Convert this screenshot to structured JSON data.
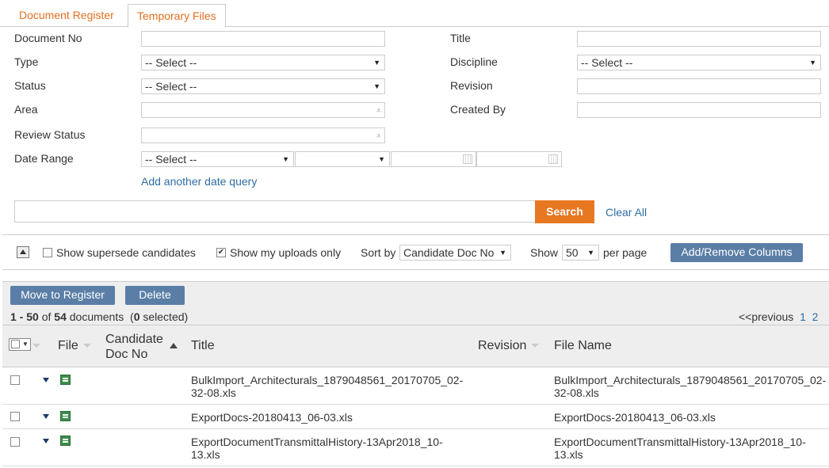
{
  "tabs": [
    "Document Register",
    "Temporary Files"
  ],
  "filters": {
    "document_no": "Document No",
    "title": "Title",
    "type": "Type",
    "type_value": "-- Select --",
    "discipline": "Discipline",
    "discipline_value": "-- Select --",
    "status": "Status",
    "status_value": "-- Select --",
    "revision": "Revision",
    "area": "Area",
    "created_by": "Created By",
    "review_status": "Review Status",
    "date_range": "Date Range",
    "date_range_value": "-- Select --",
    "add_date_query": "Add another date query"
  },
  "search": {
    "button": "Search",
    "clear": "Clear All"
  },
  "options": {
    "supersede": "Show supersede candidates",
    "supersede_checked": false,
    "my_uploads": "Show my uploads only",
    "my_uploads_checked": true,
    "sort_by_label": "Sort by",
    "sort_by_value": "Candidate Doc No",
    "show_label": "Show",
    "show_value": "50",
    "per_page": "per page",
    "columns_button": "Add/Remove Columns"
  },
  "actions": {
    "move": "Move to Register",
    "delete": "Delete"
  },
  "summary": {
    "range": "1 - 50",
    "of": "of",
    "total": "54",
    "docs": "documents",
    "selected_open": "(",
    "selected": "0",
    "selected_close": "selected)"
  },
  "pagination": {
    "previous": "<<previous",
    "pages": [
      "1",
      "2"
    ]
  },
  "columns": {
    "file": "File",
    "candidate_1": "Candidate",
    "candidate_2": "Doc No",
    "title": "Title",
    "revision": "Revision",
    "file_name": "File Name"
  },
  "rows": [
    {
      "title_1": "BulkImport_Architecturals_1879048561_20170705_02-",
      "title_2": "32-08.xls",
      "file_1": "BulkImport_Architecturals_1879048561_20170705_02-",
      "file_2": "32-08.xls"
    },
    {
      "title_1": "ExportDocs-20180413_06-03.xls",
      "title_2": "",
      "file_1": "ExportDocs-20180413_06-03.xls",
      "file_2": ""
    },
    {
      "title_1": "ExportDocumentTransmittalHistory-13Apr2018_10-",
      "title_2": "13.xls",
      "file_1": "ExportDocumentTransmittalHistory-13Apr2018_10-",
      "file_2": "13.xls"
    }
  ]
}
